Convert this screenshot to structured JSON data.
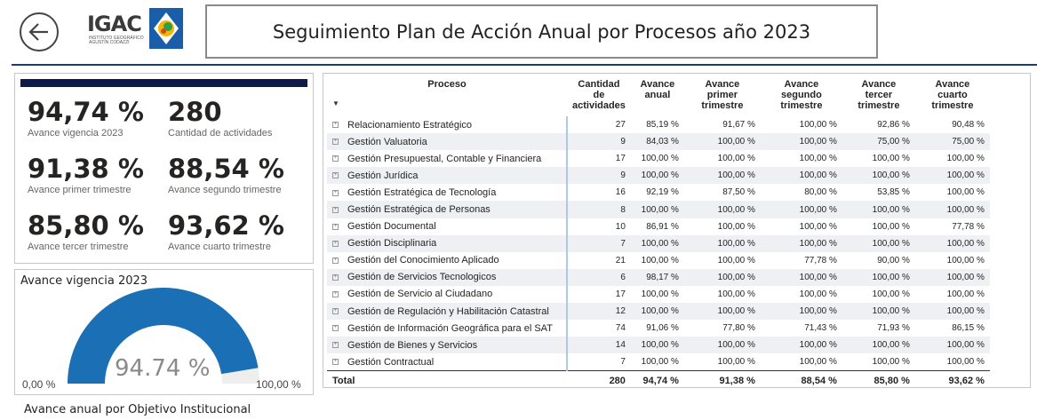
{
  "header": {
    "back_icon": "arrow-left-icon",
    "logo": {
      "text": "IGAC",
      "subtitle": "INSTITUTO GEOGRÁFICO AGUSTÍN CODAZZI"
    },
    "title": "Seguimiento Plan de Acción Anual por Procesos año 2023",
    "line_color": "#1f3b68"
  },
  "kpis": [
    {
      "value": "94,74 %",
      "label": "Avance vigencia 2023"
    },
    {
      "value": "280",
      "label": "Cantidad de actividades"
    },
    {
      "value": "91,38 %",
      "label": "Avance primer trimestre"
    },
    {
      "value": "88,54 %",
      "label": "Avance segundo trimestre"
    },
    {
      "value": "85,80 %",
      "label": "Avance tercer trimestre"
    },
    {
      "value": "93,62 %",
      "label": "Avance cuarto trimestre"
    }
  ],
  "gauge": {
    "title": "Avance vigencia 2023",
    "value": 94.74,
    "value_label": "94.74 %",
    "min_label": "0,00 %",
    "max_label": "100,00 %",
    "fill_color": "#1a6fb5",
    "track_color": "#eeeeee"
  },
  "table": {
    "columns": [
      "Proceso",
      "Cantidad de actividades",
      "Avance anual",
      "Avance primer trimestre",
      "Avance segundo trimestre",
      "Avance tercer trimestre",
      "Avance cuarto trimestre"
    ],
    "rows": [
      [
        "Relacionamiento Estratégico",
        "27",
        "85,19 %",
        "91,67 %",
        "100,00 %",
        "92,86 %",
        "90,48 %"
      ],
      [
        "Gestión Valuatoria",
        "9",
        "84,03 %",
        "100,00 %",
        "100,00 %",
        "75,00 %",
        "75,00 %"
      ],
      [
        "Gestión Presupuestal, Contable y Financiera",
        "17",
        "100,00 %",
        "100,00 %",
        "100,00 %",
        "100,00 %",
        "100,00 %"
      ],
      [
        "Gestión Jurídica",
        "9",
        "100,00 %",
        "100,00 %",
        "100,00 %",
        "100,00 %",
        "100,00 %"
      ],
      [
        "Gestión Estratégica de Tecnología",
        "16",
        "92,19 %",
        "87,50 %",
        "80,00 %",
        "53,85 %",
        "100,00 %"
      ],
      [
        "Gestión Estratégica de Personas",
        "8",
        "100,00 %",
        "100,00 %",
        "100,00 %",
        "100,00 %",
        "100,00 %"
      ],
      [
        "Gestión Documental",
        "10",
        "86,91 %",
        "100,00 %",
        "100,00 %",
        "100,00 %",
        "77,78 %"
      ],
      [
        "Gestión Disciplinaria",
        "7",
        "100,00 %",
        "100,00 %",
        "100,00 %",
        "100,00 %",
        "100,00 %"
      ],
      [
        "Gestión del Conocimiento Aplicado",
        "21",
        "100,00 %",
        "100,00 %",
        "77,78 %",
        "90,00 %",
        "100,00 %"
      ],
      [
        "Gestión de Servicios Tecnologicos",
        "6",
        "98,17 %",
        "100,00 %",
        "100,00 %",
        "100,00 %",
        "100,00 %"
      ],
      [
        "Gestión de Servicio al Ciudadano",
        "17",
        "100,00 %",
        "100,00 %",
        "100,00 %",
        "100,00 %",
        "100,00 %"
      ],
      [
        "Gestión de Regulación y Habilitación Catastral",
        "12",
        "100,00 %",
        "100,00 %",
        "100,00 %",
        "100,00 %",
        "100,00 %"
      ],
      [
        "Gestión de Información Geográfica para el SAT",
        "74",
        "91,06 %",
        "77,80 %",
        "71,43 %",
        "71,93 %",
        "86,15 %"
      ],
      [
        "Gestión de Bienes y Servicios",
        "14",
        "100,00 %",
        "100,00 %",
        "100,00 %",
        "100,00 %",
        "100,00 %"
      ],
      [
        "Gestión Contractual",
        "7",
        "100,00 %",
        "100,00 %",
        "100,00 %",
        "100,00 %",
        "100,00 %"
      ]
    ],
    "total": [
      "Total",
      "280",
      "94,74 %",
      "91,38 %",
      "88,54 %",
      "85,80 %",
      "93,62 %"
    ]
  },
  "footer": {
    "title": "Avance anual por Objetivo Institucional"
  }
}
